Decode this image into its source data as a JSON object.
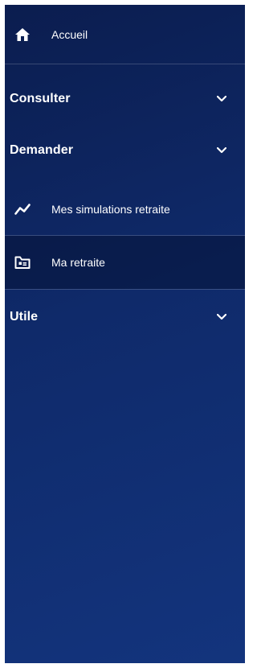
{
  "nav": {
    "home": {
      "label": "Accueil",
      "icon": "home-icon"
    },
    "sections": [
      {
        "label": "Consulter",
        "icon": "chevron-down-icon"
      },
      {
        "label": "Demander",
        "icon": "chevron-down-icon"
      },
      {
        "label": "Utile",
        "icon": "chevron-down-icon"
      }
    ],
    "items": [
      {
        "label": "Mes simulations retraite",
        "icon": "trend-line-icon"
      },
      {
        "label": "Ma retraite",
        "icon": "id-folder-icon"
      }
    ]
  },
  "colors": {
    "sidebar_top": "#0b1d4f",
    "sidebar_bottom": "#13347d",
    "text": "#ffffff"
  }
}
